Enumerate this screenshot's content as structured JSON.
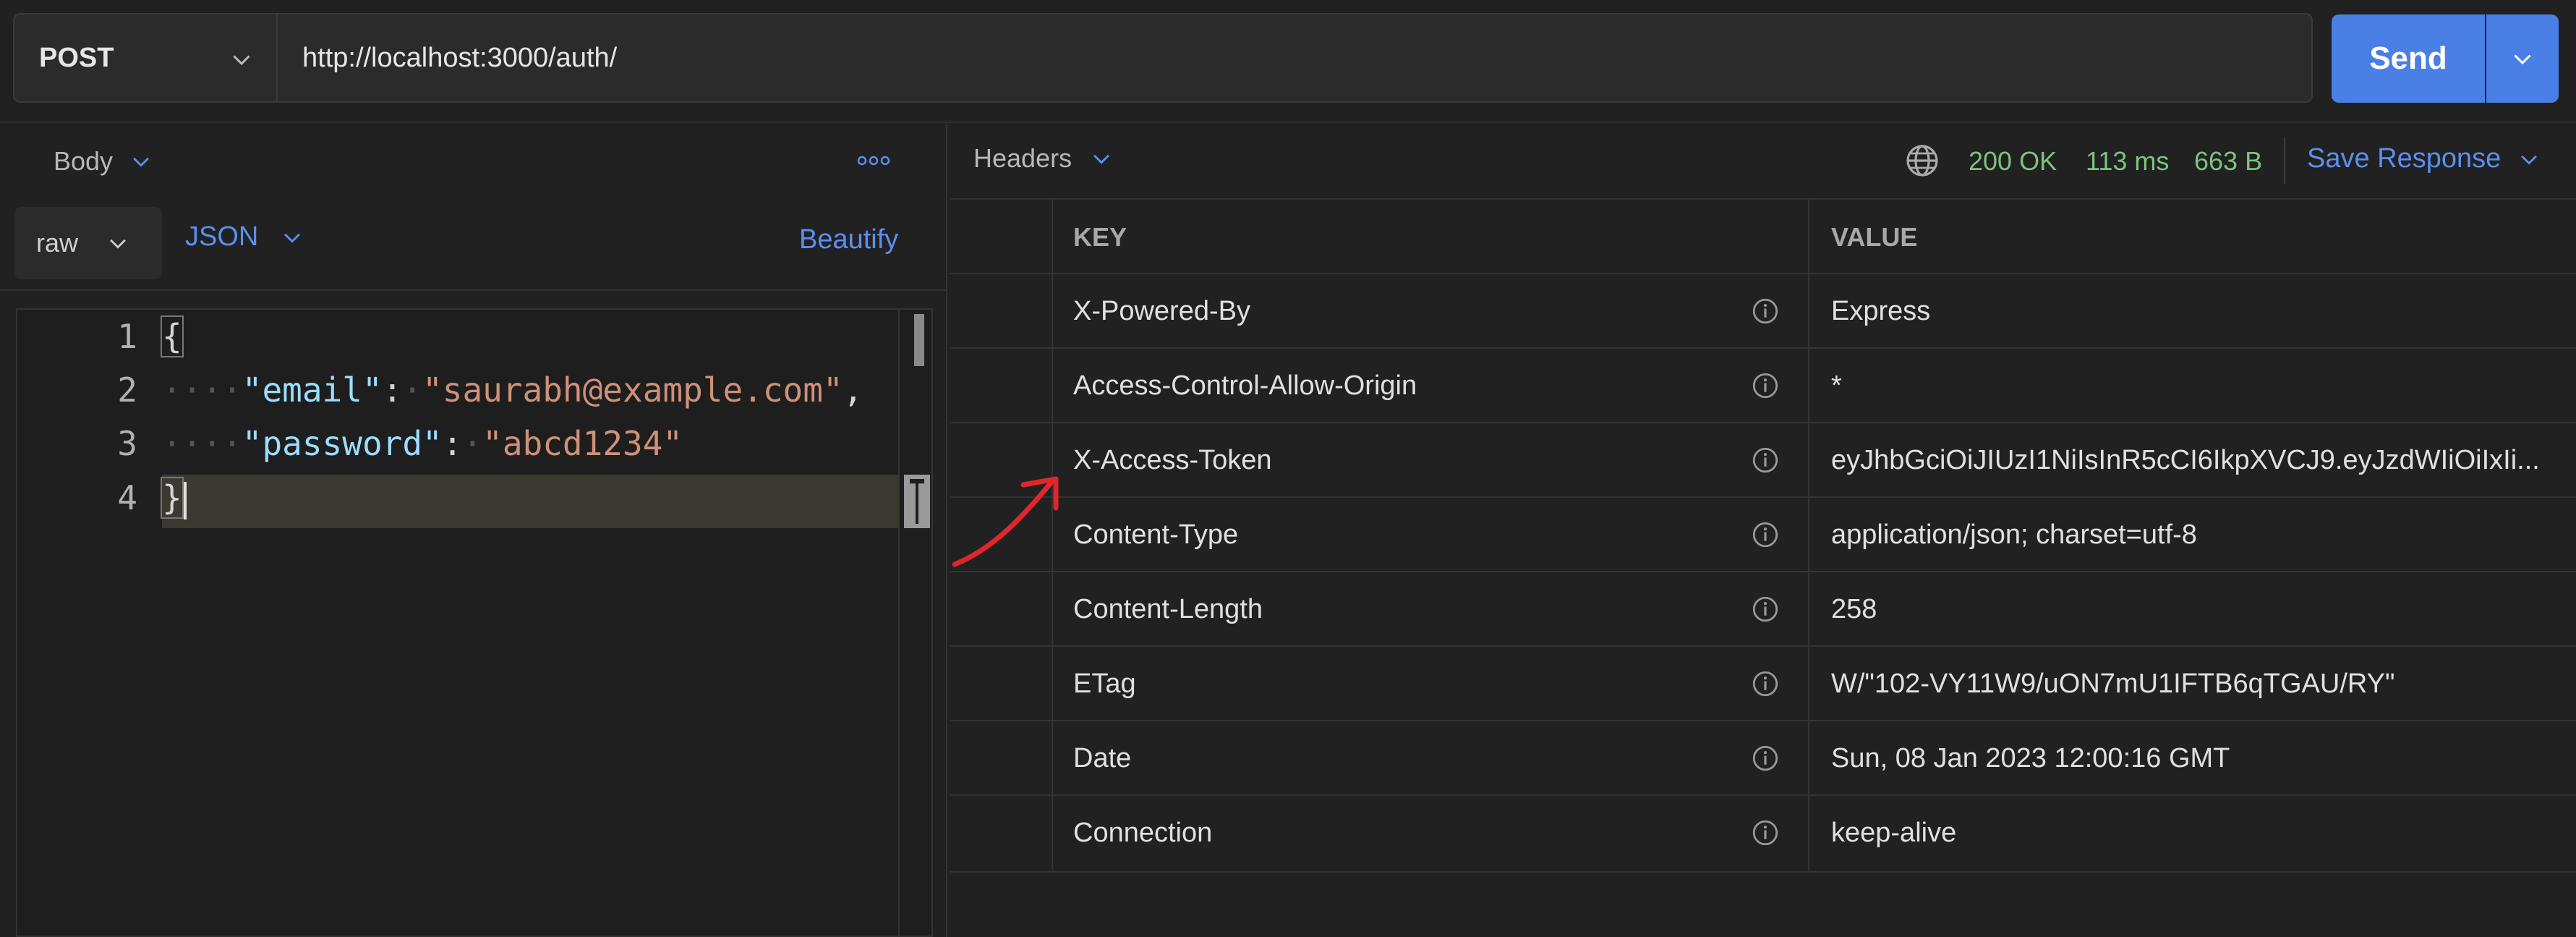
{
  "request": {
    "method": "POST",
    "url": "http://localhost:3000/auth/",
    "send_label": "Send"
  },
  "left": {
    "body_tab": "Body",
    "raw_label": "raw",
    "json_label": "JSON",
    "beautify_label": "Beautify",
    "line_numbers": [
      "1",
      "2",
      "3",
      "4"
    ],
    "code": {
      "open_brace": "{",
      "email_key": "\"email\"",
      "email_value": "\"saurabh@example.com\"",
      "password_key": "\"password\"",
      "password_value": "\"abcd1234\"",
      "close_brace": "}"
    }
  },
  "right": {
    "headers_tab": "Headers",
    "status": "200 OK",
    "time": "113 ms",
    "size": "663 B",
    "save_response": "Save Response",
    "table": {
      "key_header": "KEY",
      "value_header": "VALUE",
      "rows": [
        {
          "key": "X-Powered-By",
          "value": "Express"
        },
        {
          "key": "Access-Control-Allow-Origin",
          "value": "*"
        },
        {
          "key": "X-Access-Token",
          "value": "eyJhbGciOiJIUzI1NiIsInR5cCI6IkpXVCJ9.eyJzdWIiOiIxIi..."
        },
        {
          "key": "Content-Type",
          "value": "application/json; charset=utf-8"
        },
        {
          "key": "Content-Length",
          "value": "258"
        },
        {
          "key": "ETag",
          "value": "W/\"102-VY11W9/uON7mU1IFTB6qTGAU/RY\""
        },
        {
          "key": "Date",
          "value": "Sun, 08 Jan 2023 12:00:16 GMT"
        },
        {
          "key": "Connection",
          "value": "keep-alive"
        }
      ]
    }
  },
  "colors": {
    "accent": "#4a7fe6",
    "link": "#5b8ff0",
    "status_ok": "#7cc47c",
    "annotation": "#e0262b"
  },
  "icons": [
    "chevron-down-icon",
    "more-icon",
    "globe-icon",
    "info-icon",
    "annotation-arrow"
  ]
}
